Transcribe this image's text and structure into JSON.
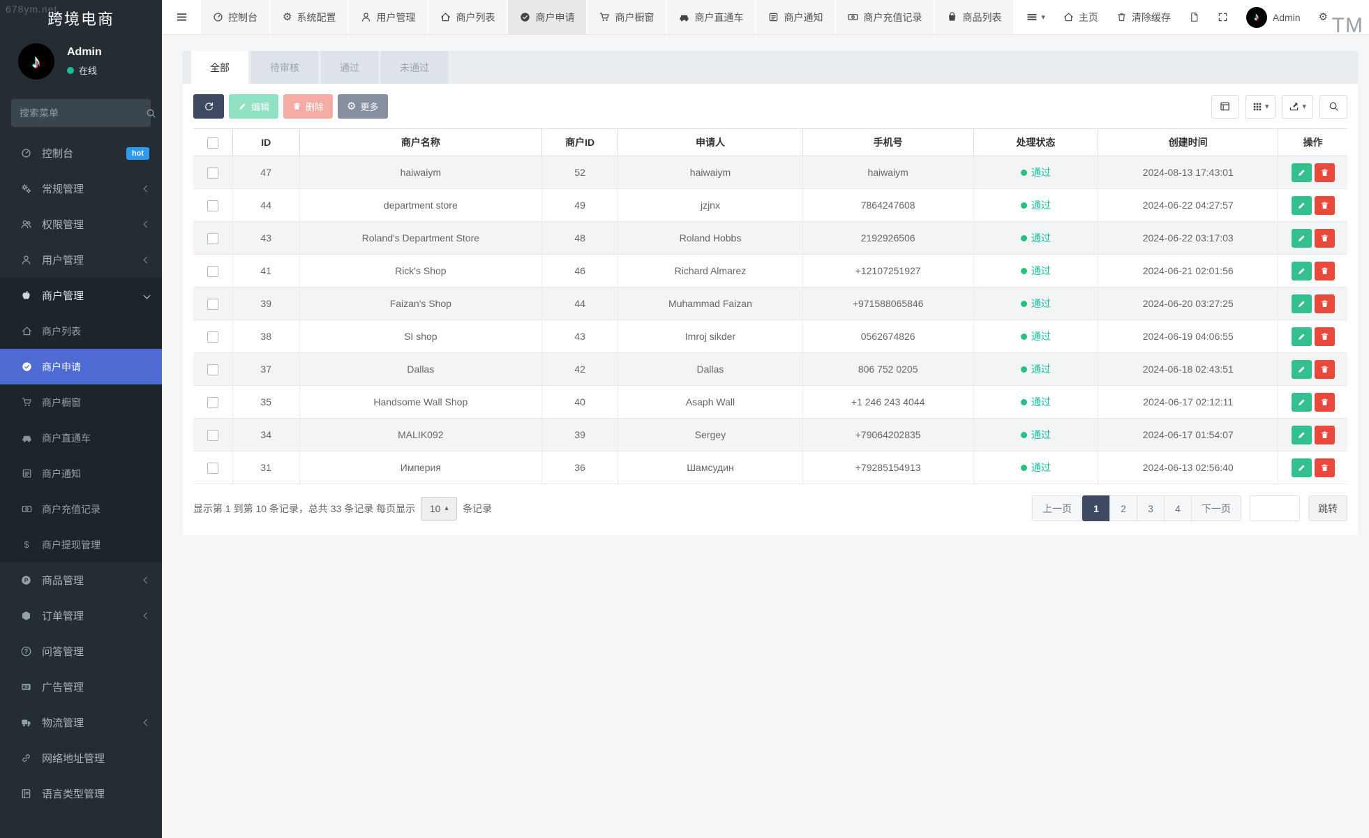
{
  "watermarks": {
    "top_left": "678ym.net",
    "top_right": "TM"
  },
  "sidebar": {
    "title": "跨境电商",
    "user": {
      "name": "Admin",
      "status": "在线"
    },
    "search_placeholder": "搜索菜单",
    "items": [
      {
        "id": "console",
        "icon": "dashboard-icon",
        "label": "控制台",
        "badge": "hot"
      },
      {
        "id": "general-mgmt",
        "icon": "cogs-icon",
        "label": "常规管理",
        "chevron": true
      },
      {
        "id": "permission-mgmt",
        "icon": "users-icon",
        "label": "权限管理",
        "chevron": true
      },
      {
        "id": "user-mgmt",
        "icon": "user-icon",
        "label": "用户管理",
        "chevron": true
      },
      {
        "id": "merchant-mgmt",
        "icon": "apple-icon",
        "label": "商户管理",
        "expanded": true,
        "children": [
          {
            "id": "merchant-list",
            "icon": "home-icon",
            "label": "商户列表"
          },
          {
            "id": "merchant-apply",
            "icon": "check-circle-icon",
            "label": "商户申请",
            "active": true
          },
          {
            "id": "merchant-showcase",
            "icon": "cart-icon",
            "label": "商户橱窗"
          },
          {
            "id": "merchant-through-train",
            "icon": "car-icon",
            "label": "商户直通车"
          },
          {
            "id": "merchant-notice",
            "icon": "notice-icon",
            "label": "商户通知"
          },
          {
            "id": "merchant-recharge",
            "icon": "money-icon",
            "label": "商户充值记录"
          },
          {
            "id": "merchant-withdraw",
            "icon": "dollar-icon",
            "label": "商户提现管理"
          }
        ]
      },
      {
        "id": "product-mgmt",
        "icon": "product-icon",
        "label": "商品管理",
        "chevron": true
      },
      {
        "id": "order-mgmt",
        "icon": "cube-icon",
        "label": "订单管理",
        "chevron": true
      },
      {
        "id": "qa-mgmt",
        "icon": "question-icon",
        "label": "问答管理"
      },
      {
        "id": "ad-mgmt",
        "icon": "ad-icon",
        "label": "广告管理"
      },
      {
        "id": "logistics-mgmt",
        "icon": "truck-icon",
        "label": "物流管理",
        "chevron": true
      },
      {
        "id": "network-address-mgmt",
        "icon": "link-icon",
        "label": "网络地址管理"
      },
      {
        "id": "language-type-mgmt",
        "icon": "language-icon",
        "label": "语言类型管理"
      }
    ]
  },
  "topnav": {
    "tabs": [
      {
        "id": "console",
        "icon": "dashboard-icon",
        "label": "控制台"
      },
      {
        "id": "system-config",
        "icon": "gear-icon",
        "label": "系统配置"
      },
      {
        "id": "user-mgmt",
        "icon": "user-icon",
        "label": "用户管理"
      },
      {
        "id": "merchant-list",
        "icon": "home-icon",
        "label": "商户列表"
      },
      {
        "id": "merchant-apply",
        "icon": "check-circle-icon",
        "label": "商户申请",
        "active": true
      },
      {
        "id": "merchant-showcase",
        "icon": "cart-icon",
        "label": "商户橱窗"
      },
      {
        "id": "merchant-through-train",
        "icon": "car-icon",
        "label": "商户直通车"
      },
      {
        "id": "merchant-notice",
        "icon": "notice-icon",
        "label": "商户通知"
      },
      {
        "id": "merchant-recharge",
        "icon": "money-icon",
        "label": "商户充值记录"
      },
      {
        "id": "product-list",
        "icon": "bag-icon",
        "label": "商品列表"
      }
    ],
    "right": {
      "home": "主页",
      "clear_cache": "清除缓存",
      "user": "Admin"
    }
  },
  "filter_tabs": [
    {
      "label": "全部",
      "active": true
    },
    {
      "label": "待审核"
    },
    {
      "label": "通过"
    },
    {
      "label": "未通过"
    }
  ],
  "toolbar": {
    "edit": "编辑",
    "delete": "删除",
    "more": "更多"
  },
  "table": {
    "columns": [
      "ID",
      "商户名称",
      "商户ID",
      "申请人",
      "手机号",
      "处理状态",
      "创建时间",
      "操作"
    ],
    "status_pass": "通过",
    "rows": [
      {
        "id": "47",
        "name": "haiwaiym",
        "merchant_id": "52",
        "applicant": "haiwaiym",
        "phone": "haiwaiym",
        "status": "通过",
        "created": "2024-08-13 17:43:01"
      },
      {
        "id": "44",
        "name": "department store",
        "merchant_id": "49",
        "applicant": "jzjnx",
        "phone": "7864247608",
        "status": "通过",
        "created": "2024-06-22 04:27:57"
      },
      {
        "id": "43",
        "name": "Roland's Department Store",
        "merchant_id": "48",
        "applicant": "Roland Hobbs",
        "phone": "2192926506",
        "status": "通过",
        "created": "2024-06-22 03:17:03"
      },
      {
        "id": "41",
        "name": "Rick's Shop",
        "merchant_id": "46",
        "applicant": "Richard Almarez",
        "phone": "+12107251927",
        "status": "通过",
        "created": "2024-06-21 02:01:56"
      },
      {
        "id": "39",
        "name": "Faizan's Shop",
        "merchant_id": "44",
        "applicant": "Muhammad Faizan",
        "phone": "+971588065846",
        "status": "通过",
        "created": "2024-06-20 03:27:25"
      },
      {
        "id": "38",
        "name": "SI shop",
        "merchant_id": "43",
        "applicant": "Imroj sikder",
        "phone": "0562674826",
        "status": "通过",
        "created": "2024-06-19 04:06:55"
      },
      {
        "id": "37",
        "name": "Dallas",
        "merchant_id": "42",
        "applicant": "Dallas",
        "phone": "806 752 0205",
        "status": "通过",
        "created": "2024-06-18 02:43:51"
      },
      {
        "id": "35",
        "name": "Handsome Wall Shop",
        "merchant_id": "40",
        "applicant": "Asaph Wall",
        "phone": "+1 246 243 4044",
        "status": "通过",
        "created": "2024-06-17 02:12:11"
      },
      {
        "id": "34",
        "name": "MALIK092",
        "merchant_id": "39",
        "applicant": "Sergey",
        "phone": "+79064202835",
        "status": "通过",
        "created": "2024-06-17 01:54:07"
      },
      {
        "id": "31",
        "name": "Империя",
        "merchant_id": "36",
        "applicant": "Шамсудин",
        "phone": "+79285154913",
        "status": "通过",
        "created": "2024-06-13 02:56:40"
      }
    ]
  },
  "footer": {
    "summary_prefix": "显示第 1 到第 10 条记录，总共 33 条记录 每页显示",
    "page_size": "10",
    "summary_suffix": "条记录",
    "pagination": {
      "prev": "上一页",
      "pages": [
        "1",
        "2",
        "3",
        "4"
      ],
      "active_page": "1",
      "next": "下一页",
      "jump": "跳转"
    }
  },
  "colors": {
    "sidebar_bg": "#232d33",
    "sidebar_group_bg": "#1d252b",
    "active_menu": "#4e6bd3",
    "accent_teal": "#1abc9c",
    "badge_blue": "#2d9bf0",
    "btn_dark": "#3e4a62",
    "btn_edit": "#5dd5a8",
    "btn_delete": "#f1867c",
    "btn_more": "#868fa0",
    "row_stripe": "#f3f4f5",
    "status_dot": "#26c07f"
  }
}
